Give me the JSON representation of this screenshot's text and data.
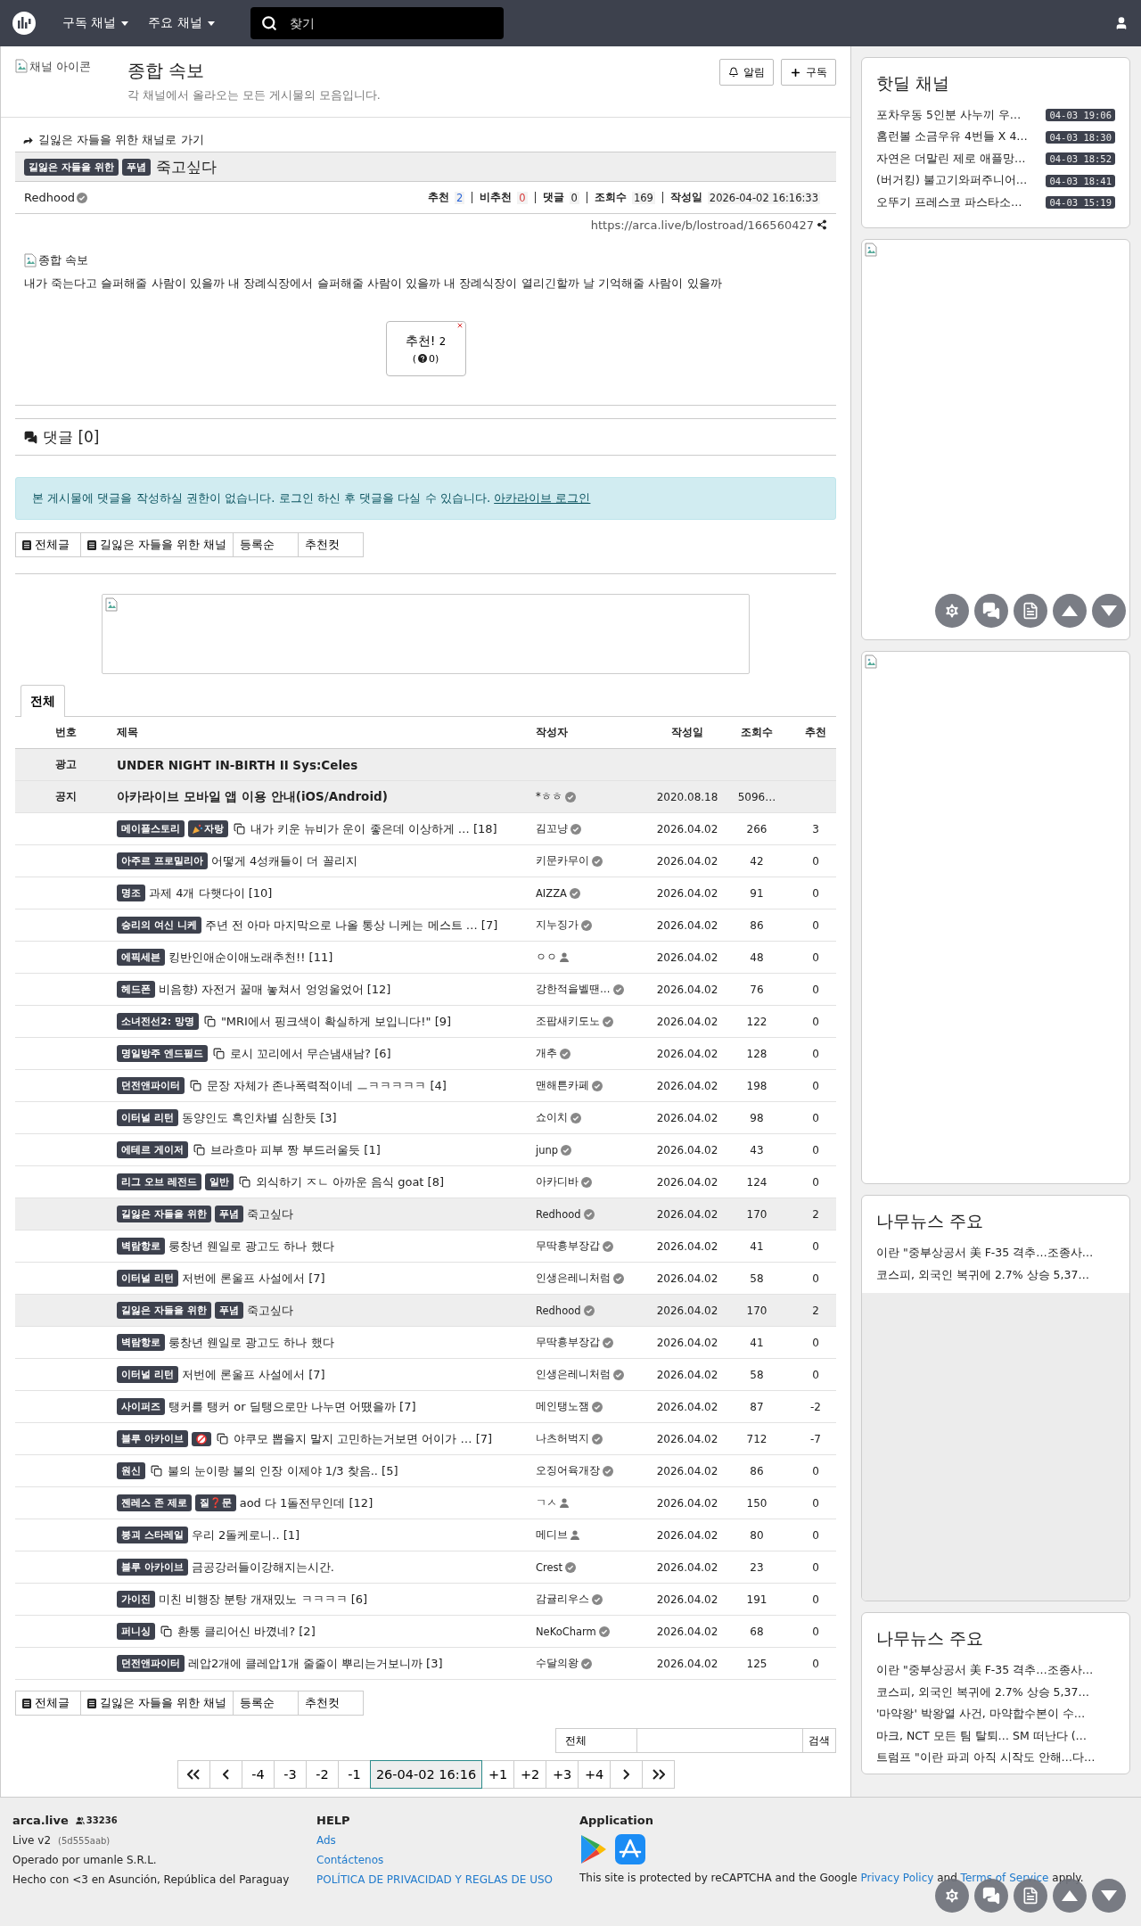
{
  "nav": {
    "menus": [
      "구독 채널",
      "주요 채널"
    ],
    "search": {
      "placeholder": "찾기"
    }
  },
  "channel": {
    "icon_alt": "채널 아이콘",
    "title": "종합 속보",
    "description": "각 채널에서 올라오는 모든 게시물의 모음입니다.",
    "buttons": [
      {
        "kind": "bell",
        "label": "알림"
      },
      {
        "kind": "plus",
        "label": "구독"
      }
    ]
  },
  "article": {
    "goto": "길잃은 자들을 위한 채널로 가기",
    "tags": [
      "길잃은 자들을 위한",
      "푸념"
    ],
    "title": "죽고싶다",
    "author": "Redhood",
    "stats": [
      {
        "label": "추천",
        "value": "2",
        "kind": "up"
      },
      {
        "label": "비추천",
        "value": "0",
        "kind": "down"
      },
      {
        "label": "댓글",
        "value": "0",
        "kind": "plain"
      },
      {
        "label": "조회수",
        "value": "169",
        "kind": "plain"
      },
      {
        "label": "작성일",
        "value": "2026-04-02 16:16:33",
        "kind": "plain"
      }
    ],
    "url": "https://arca.live/b/lostroad/166560427",
    "image_alt": "종합 속보",
    "body": "내가 죽는다고 슬퍼해줄 사람이 있을까 내 장례식장에서 슬퍼해줄 사람이 있을까 내 장례식장이 열리긴할까 날 기억해줄 사람이 있을까",
    "vote": {
      "label": "추천!",
      "count": "2",
      "down_open": "(",
      "down": "0)"
    }
  },
  "comments": {
    "title": "댓글 [0]",
    "alert": "본 게시물에 댓글을 작성하실 권한이 없습니다. 로그인 하신 후 댓글을 다실 수 있습니다.",
    "login_link": "아카라이브 로그인"
  },
  "filters": [
    {
      "label": "전체글",
      "kind": "board"
    },
    {
      "label": "길잃은 자들을 위한 채널",
      "kind": "board"
    },
    {
      "label": "등록순",
      "kind": "sort"
    },
    {
      "label": "추천컷",
      "kind": "sort"
    }
  ],
  "tabs": [
    {
      "label": "전체",
      "selected": true
    }
  ],
  "table": {
    "columns": [
      "번호",
      "제목",
      "작성자",
      "작성일",
      "조회수",
      "추천"
    ],
    "rows": [
      {
        "kind": "ad",
        "number": "광고",
        "title": "UNDER NIGHT IN-BIRTH II Sys:Celes"
      },
      {
        "kind": "notice",
        "number": "공지",
        "title": "아카라이브 모바일 앱 이용 안내(iOS/Android)",
        "author": "*ㅎㅎ",
        "verified": true,
        "date": "2020.08.18",
        "views": "5096…"
      },
      {
        "kind": "post",
        "current": false,
        "tags": [
          {
            "label": "메이플스토리"
          },
          {
            "label": "자랑",
            "kind": "party"
          }
        ],
        "media": true,
        "title": "내가 키운 뉴비가 운이 좋은데 이상하게 … [18]",
        "author": "김꼬냥",
        "verified": true,
        "date": "2026.04.02",
        "views": "266",
        "votes": "3"
      },
      {
        "kind": "post",
        "current": false,
        "tags": [
          {
            "label": "아주르 프로밀리아"
          }
        ],
        "media": false,
        "title": "어떻게 4성캐들이 더 꼴리지",
        "author": "키문카무이",
        "verified": true,
        "date": "2026.04.02",
        "views": "42",
        "votes": "0"
      },
      {
        "kind": "post",
        "current": false,
        "tags": [
          {
            "label": "명조"
          }
        ],
        "media": false,
        "title": "과제 4개 다햇다이 [10]",
        "author": "AIZZA",
        "verified": true,
        "date": "2026.04.02",
        "views": "91",
        "votes": "0"
      },
      {
        "kind": "post",
        "current": false,
        "tags": [
          {
            "label": "승리의 여신 니케"
          }
        ],
        "media": false,
        "title": "주년 전 아마 마지막으로 나올 통상 니케는 메스트 … [7]",
        "author": "지누징가",
        "verified": true,
        "date": "2026.04.02",
        "views": "86",
        "votes": "0"
      },
      {
        "kind": "post",
        "current": false,
        "tags": [
          {
            "label": "에픽세븐"
          }
        ],
        "media": false,
        "title": "킹반인애순이애노래추천!! [11]",
        "author": "ㅇㅇ",
        "verified": false,
        "date": "2026.04.02",
        "views": "48",
        "votes": "0"
      },
      {
        "kind": "post",
        "current": false,
        "tags": [
          {
            "label": "헤드폰"
          }
        ],
        "media": false,
        "title": "비음향) 자전거 꿀매 놓쳐서 엉엉울었어 [12]",
        "author": "강한적을벨땐…",
        "verified": true,
        "date": "2026.04.02",
        "views": "76",
        "votes": "0"
      },
      {
        "kind": "post",
        "current": false,
        "tags": [
          {
            "label": "소녀전선2: 망명"
          }
        ],
        "media": true,
        "title": "\"MRI에서 핑크색이 확실하게 보입니다!\" [9]",
        "author": "조팝새키도노",
        "verified": true,
        "date": "2026.04.02",
        "views": "122",
        "votes": "0"
      },
      {
        "kind": "post",
        "current": false,
        "tags": [
          {
            "label": "명일방주 엔드필드"
          }
        ],
        "media": true,
        "title": "로시 꼬리에서 무슨냄새남? [6]",
        "author": "개추",
        "verified": true,
        "date": "2026.04.02",
        "views": "128",
        "votes": "0"
      },
      {
        "kind": "post",
        "current": false,
        "tags": [
          {
            "label": "던전앤파이터"
          }
        ],
        "media": true,
        "title": "문장 자체가 존나폭력적이네 ㅡㅋㅋㅋㅋㅋ [4]",
        "author": "맨해튼카페",
        "verified": true,
        "date": "2026.04.02",
        "views": "198",
        "votes": "0"
      },
      {
        "kind": "post",
        "current": false,
        "tags": [
          {
            "label": "이터널 리턴"
          }
        ],
        "media": false,
        "title": "동양인도 흑인차별 심한듯 [3]",
        "author": "쇼이치",
        "verified": true,
        "date": "2026.04.02",
        "views": "98",
        "votes": "0"
      },
      {
        "kind": "post",
        "current": false,
        "tags": [
          {
            "label": "에테르 게이저"
          }
        ],
        "media": true,
        "title": "브라흐마 피부 짱 부드러울듯 [1]",
        "author": "junp",
        "verified": true,
        "date": "2026.04.02",
        "views": "43",
        "votes": "0"
      },
      {
        "kind": "post",
        "current": false,
        "tags": [
          {
            "label": "리그 오브 레전드"
          },
          {
            "label": "일반"
          }
        ],
        "media": true,
        "title": "외식하기 ㅈㄴ 아까운 음식 goat [8]",
        "author": "아카디바",
        "verified": true,
        "date": "2026.04.02",
        "views": "124",
        "votes": "0"
      },
      {
        "kind": "post",
        "current": true,
        "tags": [
          {
            "label": "길잃은 자들을 위한"
          },
          {
            "label": "푸념"
          }
        ],
        "media": false,
        "title": "죽고싶다",
        "author": "Redhood",
        "verified": true,
        "date": "2026.04.02",
        "views": "170",
        "votes": "2"
      },
      {
        "kind": "post",
        "current": false,
        "tags": [
          {
            "label": "벽람항로"
          }
        ],
        "media": false,
        "title": "룽창년 웬일로 광고도 하나 했다",
        "author": "무딱흉부장갑",
        "verified": true,
        "date": "2026.04.02",
        "views": "41",
        "votes": "0"
      },
      {
        "kind": "post",
        "current": false,
        "tags": [
          {
            "label": "이터널 리턴"
          }
        ],
        "media": false,
        "title": "저번에 론울프 사설에서 [7]",
        "author": "인생은레니처럼",
        "verified": true,
        "date": "2026.04.02",
        "views": "58",
        "votes": "0"
      },
      {
        "kind": "post",
        "current": true,
        "tags": [
          {
            "label": "길잃은 자들을 위한"
          },
          {
            "label": "푸념"
          }
        ],
        "media": false,
        "title": "죽고싶다",
        "author": "Redhood",
        "verified": true,
        "date": "2026.04.02",
        "views": "170",
        "votes": "2"
      },
      {
        "kind": "post",
        "current": false,
        "tags": [
          {
            "label": "벽람항로"
          }
        ],
        "media": false,
        "title": "룽창년 웬일로 광고도 하나 했다",
        "author": "무딱흉부장갑",
        "verified": true,
        "date": "2026.04.02",
        "views": "41",
        "votes": "0"
      },
      {
        "kind": "post",
        "current": false,
        "tags": [
          {
            "label": "이터널 리턴"
          }
        ],
        "media": false,
        "title": "저번에 론울프 사설에서 [7]",
        "author": "인생은레니처럼",
        "verified": true,
        "date": "2026.04.02",
        "views": "58",
        "votes": "0"
      },
      {
        "kind": "post",
        "current": false,
        "tags": [
          {
            "label": "사이퍼즈"
          }
        ],
        "media": false,
        "title": "탱커를 탱커 or 딜탱으로만 나누면 어땠을까 [7]",
        "author": "메인탱노잼",
        "verified": true,
        "date": "2026.04.02",
        "views": "87",
        "votes": "-2"
      },
      {
        "kind": "post",
        "current": false,
        "tags": [
          {
            "label": "블루 아카이브"
          },
          {
            "kind": "adult"
          }
        ],
        "media": true,
        "title": "야쿠모 뽑을지 말지 고민하는거보면 어이가 … [7]",
        "author": "나츠허벅지",
        "verified": true,
        "date": "2026.04.02",
        "views": "712",
        "votes": "-7"
      },
      {
        "kind": "post",
        "current": false,
        "tags": [
          {
            "label": "원신"
          }
        ],
        "media": true,
        "title": "불의 눈이랑 불의 인장 이제야 1/3 찾음.. [5]",
        "author": "오징어육개장",
        "verified": true,
        "date": "2026.04.02",
        "views": "86",
        "votes": "0"
      },
      {
        "kind": "post",
        "current": false,
        "tags": [
          {
            "label": "젠레스 존 제로"
          },
          {
            "label": "질❓문"
          }
        ],
        "media": false,
        "title": "aod 다 1돌전무인데 [12]",
        "author": "ㄱㅅ",
        "verified": false,
        "date": "2026.04.02",
        "views": "150",
        "votes": "0"
      },
      {
        "kind": "post",
        "current": false,
        "tags": [
          {
            "label": "붕괴 스타레일"
          }
        ],
        "media": false,
        "title": "우리 2돌케로니.. [1]",
        "author": "메디브",
        "verified": false,
        "date": "2026.04.02",
        "views": "80",
        "votes": "0"
      },
      {
        "kind": "post",
        "current": false,
        "tags": [
          {
            "label": "블루 아카이브"
          }
        ],
        "media": false,
        "title": "금공강러들이강해지는시간.",
        "author": "Crest",
        "verified": true,
        "date": "2026.04.02",
        "views": "23",
        "votes": "0"
      },
      {
        "kind": "post",
        "current": false,
        "tags": [
          {
            "label": "가이진"
          }
        ],
        "media": false,
        "title": "미친 비행장 분탕 개재밌노 ㅋㅋㅋㅋ [6]",
        "author": "감귤리우스",
        "verified": true,
        "date": "2026.04.02",
        "views": "191",
        "votes": "0"
      },
      {
        "kind": "post",
        "current": false,
        "tags": [
          {
            "label": "퍼니싱"
          }
        ],
        "media": true,
        "title": "환통 클리어신 바꼈네? [2]",
        "author": "NeKoCharm",
        "verified": true,
        "date": "2026.04.02",
        "views": "68",
        "votes": "0"
      },
      {
        "kind": "post",
        "current": false,
        "tags": [
          {
            "label": "던전앤파이터"
          }
        ],
        "media": false,
        "title": "레압2개에 클레압1개 줄줄이 뿌리는거보니까 [3]",
        "author": "수달의왕",
        "verified": true,
        "date": "2026.04.02",
        "views": "125",
        "votes": "0"
      }
    ]
  },
  "bottom_filters": [
    {
      "label": "전체글",
      "kind": "board"
    },
    {
      "label": "길잃은 자들을 위한 채널",
      "kind": "board"
    },
    {
      "label": "등록순",
      "kind": "sort"
    },
    {
      "label": "추천컷",
      "kind": "sort"
    }
  ],
  "search": {
    "scope": "전체",
    "button": "검색"
  },
  "pagination": [
    {
      "kind": "first",
      "selected": false
    },
    {
      "kind": "prev",
      "selected": false
    },
    {
      "kind": "page",
      "label": "-4",
      "selected": false
    },
    {
      "kind": "page",
      "label": "-3",
      "selected": false
    },
    {
      "kind": "page",
      "label": "-2",
      "selected": false
    },
    {
      "kind": "page",
      "label": "-1",
      "selected": false
    },
    {
      "kind": "page",
      "label": "26-04-02 16:16",
      "selected": true
    },
    {
      "kind": "page",
      "label": "+1",
      "selected": false
    },
    {
      "kind": "page",
      "label": "+2",
      "selected": false
    },
    {
      "kind": "page",
      "label": "+3",
      "selected": false
    },
    {
      "kind": "page",
      "label": "+4",
      "selected": false
    },
    {
      "kind": "next",
      "selected": false
    },
    {
      "kind": "last",
      "selected": false
    }
  ],
  "sidebar": {
    "hotdeal": {
      "title": "핫딜 채널",
      "items": [
        {
          "title": "포차우동 5인분 사누끼 우…",
          "time": "04-03 19:06"
        },
        {
          "title": "홈런볼 소금우유 4번들 X 4…",
          "time": "04-03 18:30"
        },
        {
          "title": "자연은 더말린 제로 애플망…",
          "time": "04-03 18:52"
        },
        {
          "title": "(버거킹) 불고기와퍼주니어…",
          "time": "04-03 18:41"
        },
        {
          "title": "오뚜기 프레스코 파스타소…",
          "time": "04-03 15:19"
        }
      ]
    },
    "news": [
      {
        "title": "나무뉴스 주요",
        "loading": true,
        "items": [
          "이란 \"중부상공서 美 F-35 격추…조종사…",
          "코스피, 외국인 복귀에 2.7% 상승 5,37…"
        ]
      },
      {
        "title": "나무뉴스 주요",
        "loading": false,
        "items": [
          "이란 \"중부상공서 美 F-35 격추…조종사…",
          "코스피, 외국인 복귀에 2.7% 상승 5,37…",
          "'마약왕' 박왕열 사건, 마약합수본이 수…",
          "마크, NCT 모든 팀 탈퇴… SM 떠난다 (…",
          "트럼프 \"이란 파괴 아직 시작도 안해…다…"
        ]
      }
    ]
  },
  "footer": {
    "site": "arca.live",
    "users": "33236",
    "version": "Live v2",
    "build": "(5d555aab)",
    "operator": "Operado por umanle S.R.L.",
    "made": "Hecho con <3 en Asunción, República del Paraguay",
    "help_title": "HELP",
    "help_links": [
      "Ads",
      "Contáctenos",
      "POLÍTICA DE PRIVACIDAD Y REGLAS DE USO"
    ],
    "app_title": "Application",
    "recaptcha": {
      "before": "This site is protected by reCAPTCHA and the Google",
      "privacy": "Privacy Policy",
      "middle": "and",
      "terms": "Terms of Service",
      "after": "apply."
    }
  }
}
